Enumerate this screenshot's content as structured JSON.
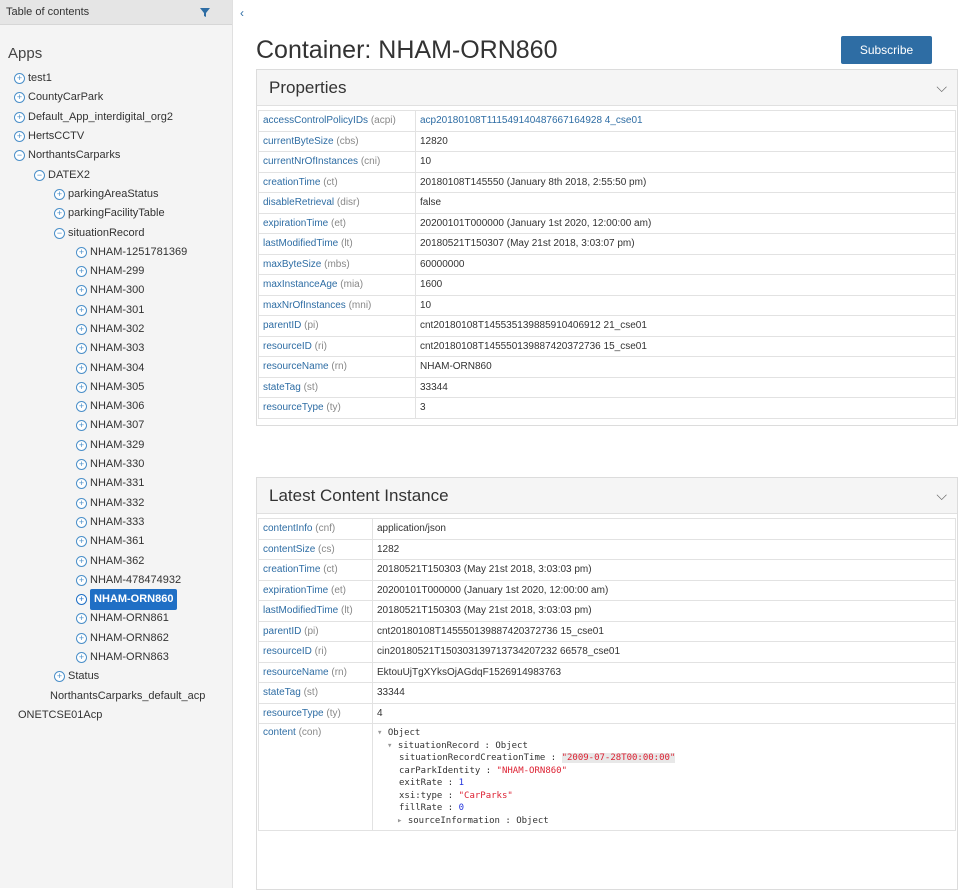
{
  "sidebar": {
    "header": "Table of contents",
    "collapse_glyph": "‹",
    "apps_title": "Apps",
    "tree": [
      {
        "label": "test1",
        "level": 0,
        "icon": "plus-circle-icon"
      },
      {
        "label": "CountyCarPark",
        "level": 0,
        "icon": "plus-circle-icon"
      },
      {
        "label": "Default_App_interdigital_org2",
        "level": 0,
        "icon": "plus-circle-icon"
      },
      {
        "label": "HertsCCTV",
        "level": 0,
        "icon": "plus-circle-icon"
      },
      {
        "label": "NorthantsCarparks",
        "level": 0,
        "icon": "minus-circle-icon"
      },
      {
        "label": "DATEX2",
        "level": 1,
        "icon": "minus-circle-icon"
      },
      {
        "label": "parkingAreaStatus",
        "level": 2,
        "icon": "plus-circle-icon"
      },
      {
        "label": "parkingFacilityTable",
        "level": 2,
        "icon": "plus-circle-icon"
      },
      {
        "label": "situationRecord",
        "level": 2,
        "icon": "minus-circle-icon"
      },
      {
        "label": "NHAM-1251781369",
        "level": 3,
        "icon": "plus-circle-icon"
      },
      {
        "label": "NHAM-299",
        "level": 3,
        "icon": "plus-circle-icon"
      },
      {
        "label": "NHAM-300",
        "level": 3,
        "icon": "plus-circle-icon"
      },
      {
        "label": "NHAM-301",
        "level": 3,
        "icon": "plus-circle-icon"
      },
      {
        "label": "NHAM-302",
        "level": 3,
        "icon": "plus-circle-icon"
      },
      {
        "label": "NHAM-303",
        "level": 3,
        "icon": "plus-circle-icon"
      },
      {
        "label": "NHAM-304",
        "level": 3,
        "icon": "plus-circle-icon"
      },
      {
        "label": "NHAM-305",
        "level": 3,
        "icon": "plus-circle-icon"
      },
      {
        "label": "NHAM-306",
        "level": 3,
        "icon": "plus-circle-icon"
      },
      {
        "label": "NHAM-307",
        "level": 3,
        "icon": "plus-circle-icon"
      },
      {
        "label": "NHAM-329",
        "level": 3,
        "icon": "plus-circle-icon"
      },
      {
        "label": "NHAM-330",
        "level": 3,
        "icon": "plus-circle-icon"
      },
      {
        "label": "NHAM-331",
        "level": 3,
        "icon": "plus-circle-icon"
      },
      {
        "label": "NHAM-332",
        "level": 3,
        "icon": "plus-circle-icon"
      },
      {
        "label": "NHAM-333",
        "level": 3,
        "icon": "plus-circle-icon"
      },
      {
        "label": "NHAM-361",
        "level": 3,
        "icon": "plus-circle-icon"
      },
      {
        "label": "NHAM-362",
        "level": 3,
        "icon": "plus-circle-icon"
      },
      {
        "label": "NHAM-478474932",
        "level": 3,
        "icon": "plus-circle-icon"
      },
      {
        "label": "NHAM-ORN860",
        "level": 3,
        "icon": "plus-circle-icon",
        "selected": true
      },
      {
        "label": "NHAM-ORN861",
        "level": 3,
        "icon": "plus-circle-icon"
      },
      {
        "label": "NHAM-ORN862",
        "level": 3,
        "icon": "plus-circle-icon"
      },
      {
        "label": "NHAM-ORN863",
        "level": 3,
        "icon": "plus-circle-icon"
      },
      {
        "label": "Status",
        "level": 2,
        "icon": "plus-circle-icon"
      },
      {
        "label": "NorthantsCarparks_default_acp",
        "level": 1,
        "icon": "none"
      },
      {
        "label": "ONETCSE01Acp",
        "level": 0,
        "icon": "none"
      }
    ]
  },
  "main": {
    "title": "Container: NHAM-ORN860",
    "subscribe_label": "Subscribe",
    "properties": {
      "title": "Properties",
      "rows": [
        {
          "key": "accessControlPolicyIDs",
          "abbr": "(acpi)",
          "value": "acp20180108T111549140487667164928 4_cse01",
          "link": true
        },
        {
          "key": "currentByteSize",
          "abbr": "(cbs)",
          "value": "12820"
        },
        {
          "key": "currentNrOfInstances",
          "abbr": "(cni)",
          "value": "10"
        },
        {
          "key": "creationTime",
          "abbr": "(ct)",
          "value": "20180108T145550 (January 8th 2018, 2:55:50 pm)"
        },
        {
          "key": "disableRetrieval",
          "abbr": "(disr)",
          "value": "false"
        },
        {
          "key": "expirationTime",
          "abbr": "(et)",
          "value": "20200101T000000 (January 1st 2020, 12:00:00 am)"
        },
        {
          "key": "lastModifiedTime",
          "abbr": "(lt)",
          "value": "20180521T150307 (May 21st 2018, 3:03:07 pm)"
        },
        {
          "key": "maxByteSize",
          "abbr": "(mbs)",
          "value": "60000000"
        },
        {
          "key": "maxInstanceAge",
          "abbr": "(mia)",
          "value": "1600"
        },
        {
          "key": "maxNrOfInstances",
          "abbr": "(mni)",
          "value": "10"
        },
        {
          "key": "parentID",
          "abbr": "(pi)",
          "value": "cnt20180108T145535139885910406912 21_cse01"
        },
        {
          "key": "resourceID",
          "abbr": "(ri)",
          "value": "cnt20180108T145550139887420372736 15_cse01"
        },
        {
          "key": "resourceName",
          "abbr": "(rn)",
          "value": "NHAM-ORN860"
        },
        {
          "key": "stateTag",
          "abbr": "(st)",
          "value": "33344"
        },
        {
          "key": "resourceType",
          "abbr": "(ty)",
          "value": "3"
        }
      ]
    },
    "latest": {
      "title": "Latest Content Instance",
      "rows": [
        {
          "key": "contentInfo",
          "abbr": "(cnf)",
          "value": "application/json"
        },
        {
          "key": "contentSize",
          "abbr": "(cs)",
          "value": "1282"
        },
        {
          "key": "creationTime",
          "abbr": "(ct)",
          "value": "20180521T150303 (May 21st 2018, 3:03:03 pm)"
        },
        {
          "key": "expirationTime",
          "abbr": "(et)",
          "value": "20200101T000000 (January 1st 2020, 12:00:00 am)"
        },
        {
          "key": "lastModifiedTime",
          "abbr": "(lt)",
          "value": "20180521T150303 (May 21st 2018, 3:03:03 pm)"
        },
        {
          "key": "parentID",
          "abbr": "(pi)",
          "value": "cnt20180108T145550139887420372736 15_cse01"
        },
        {
          "key": "resourceID",
          "abbr": "(ri)",
          "value": "cin20180521T150303139713734207232 66578_cse01"
        },
        {
          "key": "resourceName",
          "abbr": "(rn)",
          "value": "EktouUjTgXYksOjAGdqF1526914983763"
        },
        {
          "key": "stateTag",
          "abbr": "(st)",
          "value": "33344"
        },
        {
          "key": "resourceType",
          "abbr": "(ty)",
          "value": "4"
        }
      ],
      "content_key": "content",
      "content_abbr": "(con)",
      "content_lines": [
        {
          "indent": 0,
          "arrow": "▾",
          "text": "Object"
        },
        {
          "indent": 1,
          "arrow": "▾",
          "text": "situationRecord : Object"
        },
        {
          "indent": 2,
          "arrow": "",
          "text": "situationRecordCreationTime : ",
          "str": "\"2009-07-28T00:00:00\"",
          "hl": true
        },
        {
          "indent": 2,
          "arrow": "",
          "text": "carParkIdentity : ",
          "str": "\"NHAM-ORN860\""
        },
        {
          "indent": 2,
          "arrow": "",
          "text": "exitRate : ",
          "num": "1"
        },
        {
          "indent": 2,
          "arrow": "",
          "text": "xsi:type : ",
          "str": "\"CarParks\""
        },
        {
          "indent": 2,
          "arrow": "",
          "text": "fillRate : ",
          "num": "0"
        },
        {
          "indent": 2,
          "arrow": "▸",
          "text": "sourceInformation : Object"
        }
      ]
    }
  }
}
